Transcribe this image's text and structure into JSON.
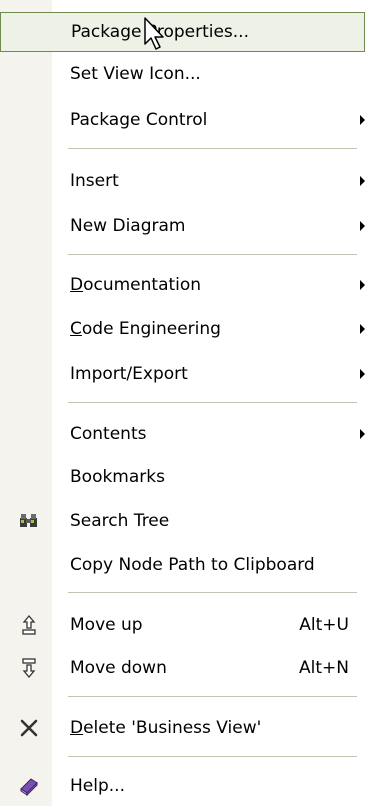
{
  "menu": {
    "items": [
      {
        "label": "Package Properties..."
      },
      {
        "label": "Set View Icon..."
      },
      {
        "label": "Package Control"
      },
      {
        "label": "Insert"
      },
      {
        "label": "New Diagram"
      },
      {
        "label_pre": "",
        "label_u": "D",
        "label_post": "ocumentation"
      },
      {
        "label_pre": "",
        "label_u": "C",
        "label_post": "ode Engineering"
      },
      {
        "label": "Import/Export"
      },
      {
        "label": "Contents"
      },
      {
        "label": "Bookmarks"
      },
      {
        "label": "Search Tree"
      },
      {
        "label": "Copy Node Path to Clipboard"
      },
      {
        "label": "Move up",
        "shortcut": "Alt+U"
      },
      {
        "label": "Move down",
        "shortcut": "Alt+N"
      },
      {
        "label_pre": "",
        "label_u": "D",
        "label_post": "elete 'Business View'"
      },
      {
        "label": "Help..."
      }
    ]
  }
}
